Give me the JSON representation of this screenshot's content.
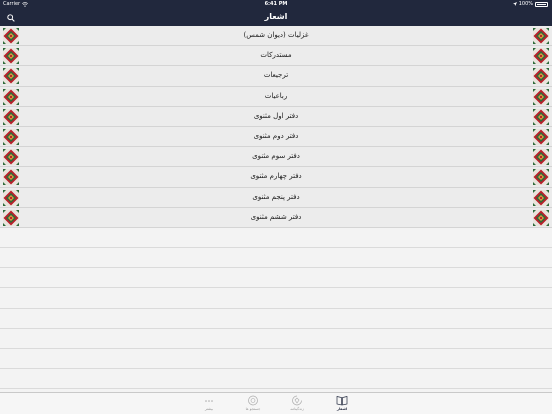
{
  "status_bar": {
    "carrier": "Carrier",
    "time": "6:41 PM",
    "battery": "100%"
  },
  "nav": {
    "title": "اشعار"
  },
  "list": {
    "items": [
      {
        "label": "غزلیات (دیوان شمس)"
      },
      {
        "label": "مستدرکات"
      },
      {
        "label": "ترجیعات"
      },
      {
        "label": "رباعیات"
      },
      {
        "label": "دفتر اول مثنوی"
      },
      {
        "label": "دفتر دوم مثنوی"
      },
      {
        "label": "دفتر سوم مثنوی"
      },
      {
        "label": "دفتر چهارم مثنوی"
      },
      {
        "label": "دفتر پنجم مثنوی"
      },
      {
        "label": "دفتر ششم مثنوی"
      }
    ]
  },
  "tabs": [
    {
      "label": "بیشتر",
      "icon": "more-icon"
    },
    {
      "label": "جستجو ها",
      "icon": "search-circle-icon"
    },
    {
      "label": "زندگینامه",
      "icon": "biography-icon"
    },
    {
      "label": "اشعار",
      "icon": "book-icon"
    }
  ],
  "colors": {
    "bar": "#21283d",
    "ornament_red": "#b8202a",
    "ornament_green": "#2e6b3a"
  }
}
